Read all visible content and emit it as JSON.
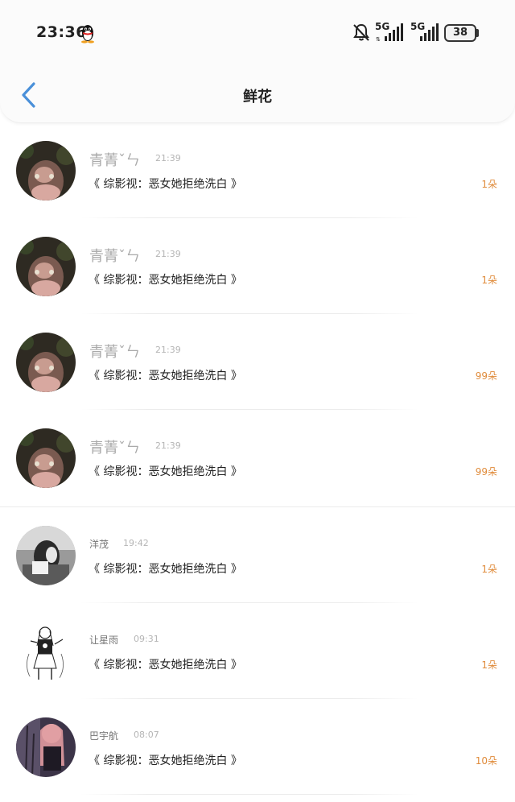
{
  "status_bar": {
    "time": "23:36",
    "signal_1": "5G",
    "signal_2": "5G",
    "battery": "38"
  },
  "nav": {
    "title": "鲜花"
  },
  "colors": {
    "accent_back": "#4a90d9",
    "flower_count": "#e08c3c"
  },
  "items": [
    {
      "name": "青菁ˇㄣ",
      "time": "21:39",
      "book": "《 综影视：恶女她拒绝洗白 》",
      "count": "1朵"
    },
    {
      "name": "青菁ˇㄣ",
      "time": "21:39",
      "book": "《 综影视：恶女她拒绝洗白 》",
      "count": "1朵"
    },
    {
      "name": "青菁ˇㄣ",
      "time": "21:39",
      "book": "《 综影视：恶女她拒绝洗白 》",
      "count": "99朵"
    },
    {
      "name": "青菁ˇㄣ",
      "time": "21:39",
      "book": "《 综影视：恶女她拒绝洗白 》",
      "count": "99朵"
    },
    {
      "name": "洋茂",
      "time": "19:42",
      "book": "《 综影视：恶女她拒绝洗白 》",
      "count": "1朵"
    },
    {
      "name": "让星雨",
      "time": "09:31",
      "book": "《 综影视：恶女她拒绝洗白 》",
      "count": "1朵"
    },
    {
      "name": "巴宇航",
      "time": "08:07",
      "book": "《 综影视：恶女她拒绝洗白 》",
      "count": "10朵"
    }
  ]
}
